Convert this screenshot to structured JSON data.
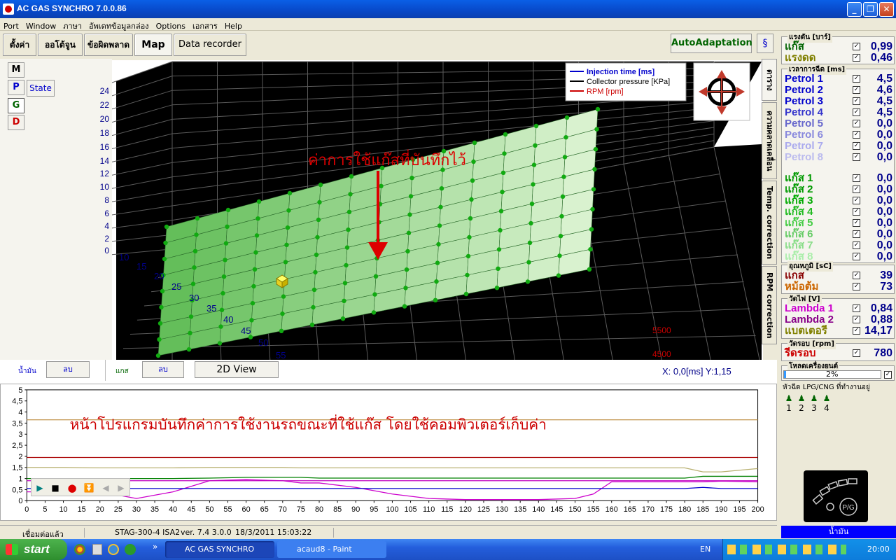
{
  "window": {
    "title": "AC GAS SYNCHRO  7.0.0.86"
  },
  "menu": [
    "Port",
    "Window",
    "ภาษา",
    "อัพเดทข้อมูลกล่อง",
    "Options",
    "เอกสาร",
    "Help"
  ],
  "tabs": [
    "ตั้งค่า",
    "ออโต้จูน",
    "ข้อผิดพลาด",
    "Map",
    "Data recorder"
  ],
  "active_tab": "Map",
  "autoadapt_label": "AutoAdaptation",
  "mode_buttons": {
    "m": "M",
    "p": "P",
    "g": "G",
    "d": "D",
    "state": "State"
  },
  "map3d": {
    "annotation": "ค่าการใช้แก๊สที่บันทึกไว้",
    "legend": [
      {
        "label": "Injection time [ms]",
        "color": "#0000CC"
      },
      {
        "label": "Collector pressure [KPa]",
        "color": "#000000"
      },
      {
        "label": "RPM [rpm]",
        "color": "#CC0000"
      }
    ],
    "y_ticks": [
      "24",
      "22",
      "20",
      "18",
      "16",
      "14",
      "12",
      "10",
      "8",
      "6",
      "4",
      "2",
      "0"
    ],
    "x_ticks": [
      "10",
      "15",
      "20",
      "25",
      "30",
      "35",
      "40",
      "45",
      "50",
      "55"
    ],
    "rpm_ticks": [
      "5500",
      "4500"
    ]
  },
  "bottom_controls": {
    "petrol_label": "น้ำมัน",
    "petrol_delete": "ลบ",
    "gas_label": "แกส",
    "gas_delete": "ลบ",
    "view2d": "2D View"
  },
  "coords": {
    "x": "X:  0,0[ms] Y:1,15"
  },
  "side_tabs": [
    "ตารางทำงาน",
    "ความคลาดเคลื่อน",
    "Temp. correction",
    "RPM correction"
  ],
  "chart2d": {
    "annotation": "หน้าโปรแกรมบันทึกค่าการใช้งานรถขณะที่ใช้แก๊ส โดยใช้คอมพิวเตอร์เก็บค่า",
    "y_ticks": [
      "5",
      "4,5",
      "4",
      "3,5",
      "3",
      "2,5",
      "2",
      "1,5",
      "1",
      "0,5",
      "0"
    ],
    "x_ticks": [
      "0",
      "5",
      "10",
      "15",
      "20",
      "25",
      "30",
      "35",
      "40",
      "45",
      "50",
      "55",
      "60",
      "65",
      "70",
      "75",
      "80",
      "85",
      "90",
      "95",
      "100",
      "105",
      "110",
      "115",
      "120",
      "125",
      "130",
      "135",
      "140",
      "145",
      "150",
      "155",
      "160",
      "165",
      "170",
      "175",
      "180",
      "185",
      "190",
      "195",
      "200"
    ]
  },
  "chart_data": {
    "type": "line",
    "x": [
      0,
      10,
      20,
      30,
      40,
      50,
      60,
      70,
      75,
      80,
      90,
      100,
      110,
      120,
      130,
      140,
      150,
      155,
      160,
      170,
      180,
      185,
      190,
      200
    ],
    "series": [
      {
        "color": "#C8A060",
        "values": [
          3.65,
          3.65,
          3.65,
          3.65,
          3.65,
          3.65,
          3.65,
          3.65,
          3.65,
          3.65,
          3.65,
          3.65,
          3.65,
          3.65,
          3.65,
          3.65,
          3.65,
          3.65,
          3.65,
          3.65,
          3.65,
          3.65,
          3.65,
          3.65
        ]
      },
      {
        "color": "#AA0000",
        "values": [
          1.95,
          1.95,
          1.95,
          1.95,
          1.95,
          1.95,
          1.95,
          1.95,
          1.95,
          1.95,
          1.95,
          1.95,
          1.95,
          1.95,
          1.95,
          1.95,
          1.95,
          1.95,
          1.95,
          1.95,
          1.95,
          1.95,
          1.95,
          1.95
        ]
      },
      {
        "color": "#B8B070",
        "values": [
          1.5,
          1.5,
          1.48,
          1.48,
          1.48,
          1.5,
          1.5,
          1.5,
          1.48,
          1.48,
          1.48,
          1.48,
          1.48,
          1.48,
          1.48,
          1.48,
          1.48,
          1.48,
          1.48,
          1.48,
          1.48,
          1.3,
          1.3,
          1.45
        ]
      },
      {
        "color": "#008000",
        "values": [
          1.0,
          1.0,
          1.0,
          1.0,
          1.0,
          1.02,
          1.05,
          1.05,
          1.05,
          1.02,
          1.02,
          1.02,
          1.02,
          1.02,
          1.02,
          1.02,
          1.02,
          1.02,
          1.02,
          1.02,
          1.02,
          1.1,
          1.1,
          1.1
        ]
      },
      {
        "color": "#CC00CC",
        "values": [
          0.4,
          0.4,
          0.4,
          0.1,
          0.4,
          0.9,
          0.95,
          0.9,
          0.8,
          0.8,
          0.6,
          0.3,
          0.1,
          0.05,
          0.05,
          0.05,
          0.1,
          0.3,
          0.85,
          0.85,
          0.85,
          0.85,
          0.88,
          0.85
        ]
      },
      {
        "color": "#0000CC",
        "values": [
          0.55,
          0.55,
          0.55,
          0.55,
          0.55,
          0.55,
          0.55,
          0.55,
          0.55,
          0.55,
          0.55,
          0.55,
          0.55,
          0.55,
          0.55,
          0.55,
          0.55,
          0.55,
          0.55,
          0.55,
          0.55,
          0.6,
          0.55,
          0.55
        ]
      },
      {
        "color": "#C000C0",
        "values": [
          0.9,
          0.9,
          0.9,
          0.9,
          0.9,
          0.9,
          0.9,
          0.9,
          0.9,
          0.9,
          0.9,
          0.9,
          0.9,
          0.9,
          0.9,
          0.9,
          0.9,
          0.9,
          0.9,
          0.9,
          0.9,
          0.9,
          0.9,
          0.9
        ]
      }
    ],
    "ylim": [
      0,
      5
    ],
    "xlim": [
      0,
      200
    ]
  },
  "right": {
    "pressure": {
      "title": "แรงดัน [บาร์]",
      "rows": [
        {
          "label": "แก๊ส",
          "value": "0,99",
          "color": "#006400"
        },
        {
          "label": "แรงดด",
          "value": "0,46",
          "color": "#808000"
        }
      ]
    },
    "injection": {
      "title": "เวลาการฉีด [ms]",
      "rows": [
        {
          "label": "Petrol 1",
          "value": "4,5",
          "color": "#0000CC"
        },
        {
          "label": "Petrol 2",
          "value": "4,6",
          "color": "#0000CC"
        },
        {
          "label": "Petrol 3",
          "value": "4,5",
          "color": "#0000CC"
        },
        {
          "label": "Petrol 4",
          "value": "4,5",
          "color": "#3333CC"
        },
        {
          "label": "Petrol 5",
          "value": "0,0",
          "color": "#6666CC"
        },
        {
          "label": "Petrol 6",
          "value": "0,0",
          "color": "#8888DD"
        },
        {
          "label": "Petrol 7",
          "value": "0,0",
          "color": "#AAAAEE"
        },
        {
          "label": "Petrol 8",
          "value": "0,0",
          "color": "#BBBBEE"
        }
      ]
    },
    "gas": {
      "rows": [
        {
          "label": "แก๊ส 1",
          "value": "0,0",
          "color": "#009900"
        },
        {
          "label": "แก๊ส 2",
          "value": "0,0",
          "color": "#009900"
        },
        {
          "label": "แก๊ส 3",
          "value": "0,0",
          "color": "#00AA00"
        },
        {
          "label": "แก๊ส 4",
          "value": "0,0",
          "color": "#22BB22"
        },
        {
          "label": "แก๊ส 5",
          "value": "0,0",
          "color": "#44CC44"
        },
        {
          "label": "แก๊ส 6",
          "value": "0,0",
          "color": "#66CC66"
        },
        {
          "label": "แก๊ส 7",
          "value": "0,0",
          "color": "#88DD88"
        },
        {
          "label": "แก๊ส 8",
          "value": "0,0",
          "color": "#AAEEAA"
        }
      ]
    },
    "temp": {
      "title": "อุณหภูมิ [sC]",
      "rows": [
        {
          "label": "แกส",
          "value": "39",
          "color": "#880000"
        },
        {
          "label": "หม้อต้ม",
          "value": "73",
          "color": "#CC6600"
        }
      ]
    },
    "voltage": {
      "title": "วัดไฟ [V]",
      "rows": [
        {
          "label": "Lambda 1",
          "value": "0,84",
          "color": "#CC00CC"
        },
        {
          "label": "Lambda 2",
          "value": "0,88",
          "color": "#880088"
        },
        {
          "label": "แบตเตอรี",
          "value": "14,17",
          "color": "#808000"
        }
      ]
    },
    "rpm": {
      "title": "วัดรอบ [rpm]",
      "rows": [
        {
          "label": "รีดรอบ",
          "value": "780",
          "color": "#CC0000"
        }
      ]
    },
    "load": {
      "title": "โหลดเครื่องยนต์",
      "value": "2%"
    },
    "injectors": {
      "title": "หัวฉีด LPG/CNG ที่ทำงานอยู่",
      "labels": [
        "1",
        "2",
        "3",
        "4"
      ]
    },
    "gauge_label": "P/G",
    "oil_label": "น้ำมัน"
  },
  "status": {
    "connected": "เชื่อมต่อแล้ว",
    "device": "STAG-300-4 ISA2",
    "version": "ver. 7.4  3.0.0",
    "datetime": "18/3/2011 15:03:22"
  },
  "taskbar": {
    "start": "start",
    "tasks": [
      "AC GAS SYNCHRO",
      "acaud8 - Paint"
    ],
    "lang": "EN",
    "clock": "20:00"
  }
}
